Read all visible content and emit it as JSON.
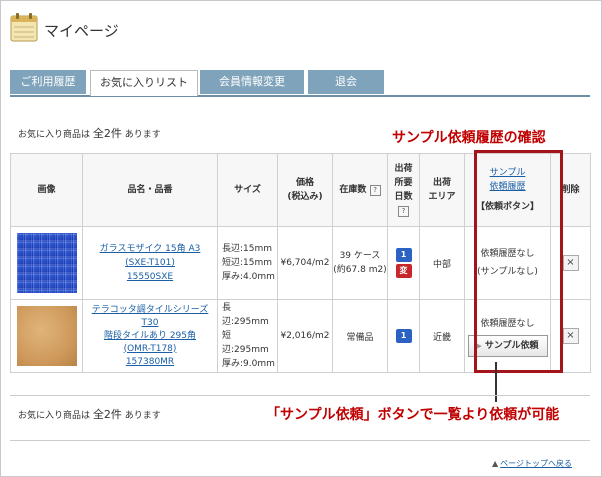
{
  "page": {
    "title": "マイページ"
  },
  "tabs": [
    {
      "label": "ご利用履歴",
      "active": false
    },
    {
      "label": "お気に入りリスト",
      "active": true
    },
    {
      "label": "会員情報変更",
      "active": false
    },
    {
      "label": "退会",
      "active": false
    }
  ],
  "favorites": {
    "prefix": "お気に入り商品は",
    "count": "全2件",
    "suffix": "あります"
  },
  "annotations": {
    "top": "サンプル依頼履歴の確認",
    "bottom": "「サンプル依頼」ボタンで一覧より依頼が可能"
  },
  "table": {
    "headers": {
      "image": "画像",
      "name": "品名・品番",
      "size": "サイズ",
      "price_line1": "価格",
      "price_line2": "(税込み)",
      "stock": "在庫数",
      "ship_days_1": "出荷",
      "ship_days_2": "所要",
      "ship_days_3": "日数",
      "area_1": "出荷",
      "area_2": "エリア",
      "sample_link_1": "サンプル",
      "sample_link_2": "依頼履歴",
      "sample_btn": "【依頼ボタン】",
      "delete": "削除",
      "help_mark": "?"
    },
    "rows": [
      {
        "name_line1": "ガラスモザイク 15角 A3",
        "name_line2": "(SXE-T101)",
        "name_line3": "15550SXE",
        "size_1": "長辺:15mm",
        "size_2": "短辺:15mm",
        "size_3": "厚み:4.0mm",
        "price": "¥6,704/m2",
        "stock_1": "39 ケース",
        "stock_2": "(約67.8 m2)",
        "ship_1": "1",
        "ship_2": "変",
        "area": "中部",
        "sample_status_1": "依頼履歴なし",
        "sample_status_2": "(サンプルなし)",
        "delete": "×",
        "thumb": "blue-glass-mosaic"
      },
      {
        "name_line1": "テラコッタ調タイルシリーズ T30",
        "name_line2": "階段タイルあり 295角",
        "name_line3": "(OMR-T178)",
        "name_line4": "157380MR",
        "size_1": "長辺:295mm",
        "size_2": "短辺:295mm",
        "size_3": "厚み:9.0mm",
        "price": "¥2,016/m2",
        "stock_1": "常備品",
        "ship_1": "1",
        "area": "近畿",
        "sample_status_1": "依頼履歴なし",
        "sample_button": "サンプル依頼",
        "delete": "×",
        "thumb": "terracotta-tile"
      }
    ]
  },
  "footer": {
    "pagetop": "ページトップへ戻る"
  },
  "colors": {
    "tab_bg": "#7fa3bb",
    "accent_red": "#a4151b",
    "link": "#1a5fa6"
  }
}
